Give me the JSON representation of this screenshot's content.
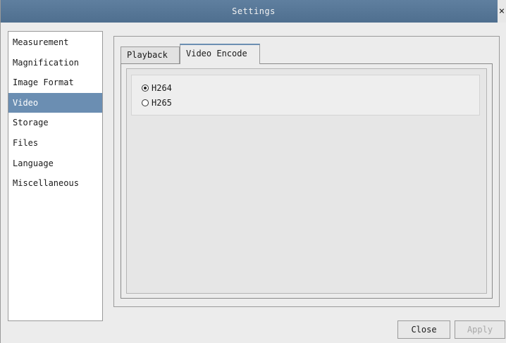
{
  "window": {
    "title": "Settings",
    "close_glyph": "×"
  },
  "sidebar": {
    "items": [
      {
        "label": "Measurement"
      },
      {
        "label": "Magnification"
      },
      {
        "label": "Image Format"
      },
      {
        "label": "Video"
      },
      {
        "label": "Storage"
      },
      {
        "label": "Files"
      },
      {
        "label": "Language"
      },
      {
        "label": "Miscellaneous"
      }
    ],
    "active": "Video"
  },
  "tabs": [
    {
      "label": "Playback"
    },
    {
      "label": "Video Encode"
    }
  ],
  "active_tab": "Video Encode",
  "encode": {
    "options": [
      {
        "label": "H264",
        "checked": true
      },
      {
        "label": "H265",
        "checked": false
      }
    ]
  },
  "buttons": {
    "close_label": "Close",
    "apply_label": "Apply"
  },
  "colors": {
    "titlebar": "#587898",
    "selection": "#6b8eb2"
  }
}
